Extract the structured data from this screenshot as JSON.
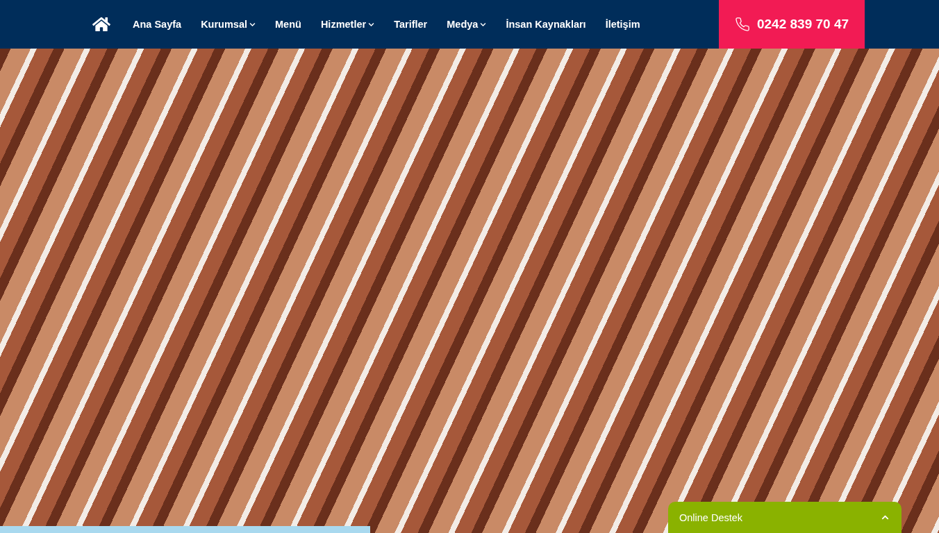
{
  "nav": {
    "items": [
      {
        "label": "Ana Sayfa",
        "dropdown": false
      },
      {
        "label": "Kurumsal",
        "dropdown": true
      },
      {
        "label": "Menü",
        "dropdown": false
      },
      {
        "label": "Hizmetler",
        "dropdown": true
      },
      {
        "label": "Tarifler",
        "dropdown": false
      },
      {
        "label": "Medya",
        "dropdown": true
      },
      {
        "label": "İnsan Kaynakları",
        "dropdown": false
      },
      {
        "label": "İletişim",
        "dropdown": false
      }
    ],
    "phone": "0242 839 70 47"
  },
  "support_widget": {
    "title": "Online Destek"
  }
}
